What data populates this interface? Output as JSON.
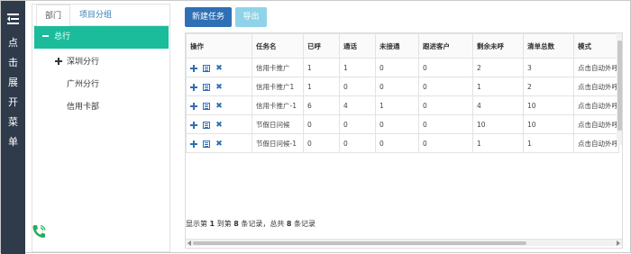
{
  "rail": {
    "menu_text": [
      "点",
      "击",
      "展",
      "开",
      "菜",
      "单"
    ]
  },
  "dept_panel": {
    "tabs": [
      {
        "label": "部门"
      },
      {
        "label": "项目分组"
      }
    ],
    "tree": {
      "root": {
        "label": "总行"
      },
      "children": [
        {
          "label": "深圳分行",
          "expandable": true
        },
        {
          "label": "广州分行",
          "expandable": false
        },
        {
          "label": "信用卡部",
          "expandable": false
        }
      ]
    }
  },
  "toolbar": {
    "new_task_label": "新建任务",
    "export_label": "导出"
  },
  "table": {
    "columns": [
      "操作",
      "任务名",
      "已呼",
      "通话",
      "未接通",
      "跟进客户",
      "剩余未呼",
      "清单总数",
      "模式"
    ],
    "rows": [
      [
        "信用卡推广",
        "1",
        "1",
        "0",
        "0",
        "2",
        "3",
        "点击自动外呼"
      ],
      [
        "信用卡推广1",
        "1",
        "0",
        "0",
        "0",
        "1",
        "2",
        "点击自动外呼"
      ],
      [
        "信用卡推广-1",
        "6",
        "4",
        "1",
        "0",
        "4",
        "10",
        "点击自动外呼"
      ],
      [
        "节假日问候",
        "0",
        "0",
        "0",
        "0",
        "10",
        "10",
        "点击自动外呼"
      ],
      [
        "节假日问候-1",
        "0",
        "0",
        "0",
        "0",
        "1",
        "1",
        "点击自动外呼"
      ]
    ]
  },
  "pager": {
    "prefix": "显示第",
    "from": "1",
    "mid": "到第",
    "to": "8",
    "mid2": "条记录，总共",
    "total": "8",
    "suffix": "条记录"
  },
  "colors": {
    "rail_bg": "#2f3a4a",
    "tree_active": "#1abc9c",
    "primary": "#2f6fb5",
    "export": "#8fd3e8",
    "phone_icon": "#27ae60"
  }
}
